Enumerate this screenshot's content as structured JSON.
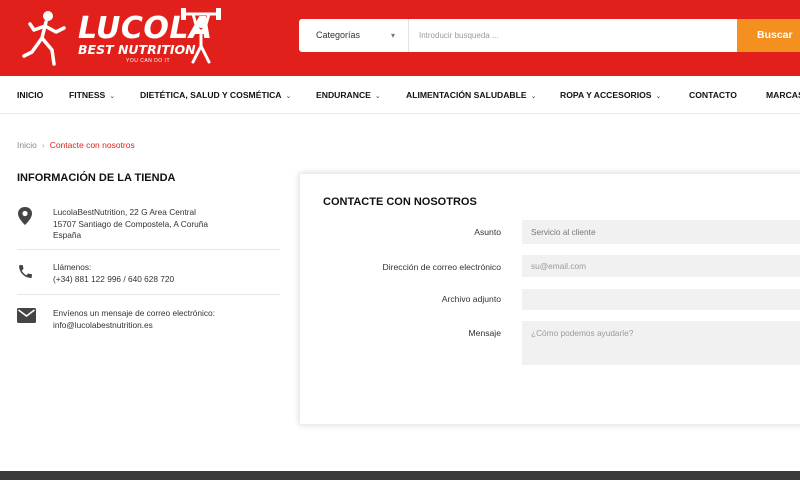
{
  "brand": {
    "name": "LUCOLA",
    "subtitle": "BEST NUTRITION",
    "tagline": "YOU CAN DO IT",
    "primary_color": "#e1201b",
    "accent_color": "#f39020"
  },
  "search": {
    "category_label": "Categorías",
    "placeholder": "Introducir busqueda ...",
    "button_label": "Buscar"
  },
  "nav": {
    "items": [
      {
        "label": "INICIO"
      },
      {
        "label": "FITNESS"
      },
      {
        "label": "DIETÉTICA, SALUD Y COSMÉTICA"
      },
      {
        "label": "ENDURANCE"
      },
      {
        "label": "ALIMENTACIÓN SALUDABLE"
      },
      {
        "label": "ROPA Y ACCESORIOS"
      },
      {
        "label": "CONTACTO"
      },
      {
        "label": "MARCAS"
      }
    ]
  },
  "breadcrumb": {
    "home": "Inicio",
    "separator": "›",
    "current": "Contacte con nosotros"
  },
  "store_info": {
    "title": "INFORMACIÓN DE LA TIENDA",
    "address": {
      "icon": "location-pin-icon",
      "line1": "LucolaBestNutrition, 22 G Area Central",
      "line2": "15707 Santiago de Compostela, A Coruña",
      "line3": "España"
    },
    "phone": {
      "icon": "phone-icon",
      "label": "Llámenos:",
      "value": "(+34) 881 122 996 / 640 628 720"
    },
    "email": {
      "icon": "mail-icon",
      "label": "Envíenos un mensaje de correo electrónico:",
      "value": "info@lucolabestnutrition.es"
    }
  },
  "contact_form": {
    "title": "CONTACTE CON NOSOTROS",
    "subject_label": "Asunto",
    "subject_value": "Servicio al cliente",
    "email_label": "Dirección de correo electrónico",
    "email_placeholder": "su@email.com",
    "attachment_label": "Archivo adjunto",
    "message_label": "Mensaje",
    "message_placeholder": "¿Cómo podemos ayudarle?"
  }
}
